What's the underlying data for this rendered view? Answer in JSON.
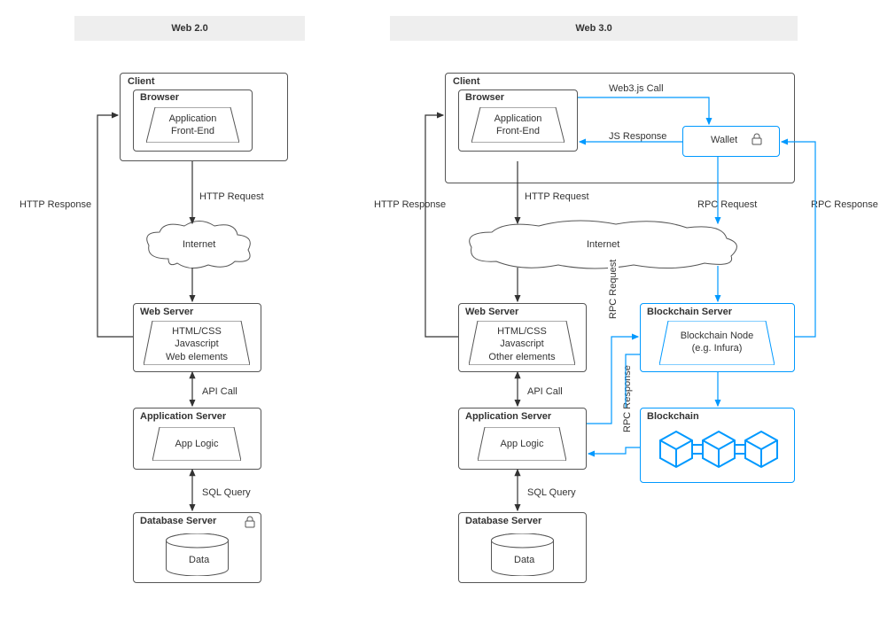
{
  "headers": {
    "web2": "Web 2.0",
    "web3": "Web 3.0"
  },
  "common": {
    "client": "Client",
    "browser": "Browser",
    "frontend": "Application\nFront-End",
    "internet": "Internet",
    "webserver": "Web Server",
    "webstack2": "HTML/CSS\nJavascript\nWeb elements",
    "webstack3": "HTML/CSS\nJavascript\nOther elements",
    "appserver": "Application Server",
    "applogic": "App Logic",
    "dbserver": "Database Server",
    "data": "Data"
  },
  "web3": {
    "wallet": "Wallet",
    "bcserver": "Blockchain Server",
    "bcnode": "Blockchain Node\n(e.g. Infura)",
    "blockchain": "Blockchain"
  },
  "edges": {
    "httpReq": "HTTP Request",
    "httpResp": "HTTP Response",
    "apiCall": "API Call",
    "sqlQuery": "SQL Query",
    "web3call": "Web3.js Call",
    "jsResp": "JS Response",
    "rpcReq": "RPC Request",
    "rpcResp": "RPC Response"
  }
}
